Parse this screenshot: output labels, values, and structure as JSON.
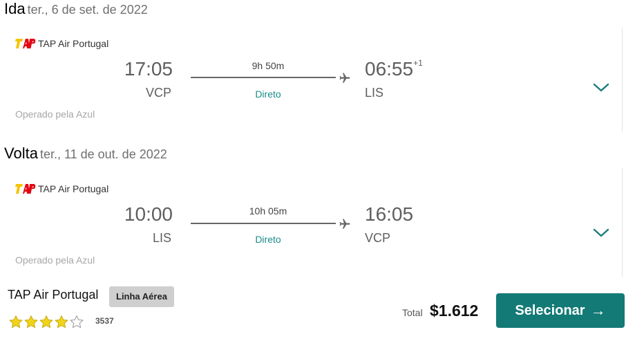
{
  "outbound": {
    "direction": "Ida",
    "date": "ter., 6 de set. de 2022",
    "airline": "TAP Air Portugal",
    "departure_time": "17:05",
    "departure_code": "VCP",
    "arrival_time": "06:55",
    "arrival_day_offset": "+1",
    "arrival_code": "LIS",
    "duration": "9h 50m",
    "stops": "Direto",
    "operated_by": "Operado pela Azul"
  },
  "inbound": {
    "direction": "Volta",
    "date": "ter., 11 de out. de 2022",
    "airline": "TAP Air Portugal",
    "departure_time": "10:00",
    "departure_code": "LIS",
    "arrival_time": "16:05",
    "arrival_code": "VCP",
    "duration": "10h 05m",
    "stops": "Direto",
    "operated_by": "Operado pela Azul"
  },
  "summary": {
    "airline": "TAP Air Portugal",
    "badge": "Linha Aérea",
    "rating": 4,
    "rating_max": 5,
    "reviews_count": "3537",
    "total_label": "Total",
    "total_price": "$1.612",
    "select_label": "Selecionar"
  },
  "colors": {
    "accent": "#137a76",
    "stops_text": "#1b8a8a",
    "star_filled": "#f2d31b",
    "logo_red": "#e30613",
    "logo_yellow": "#f5c400"
  }
}
